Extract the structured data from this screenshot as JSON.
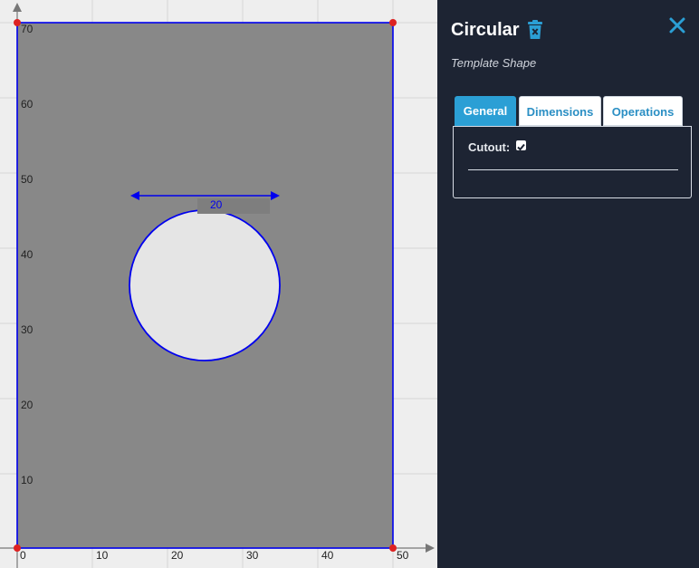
{
  "panel": {
    "title": "Circular",
    "subtitle": "Template Shape",
    "tabs": [
      {
        "label": "General",
        "active": true
      },
      {
        "label": "Dimensions",
        "active": false
      },
      {
        "label": "Operations",
        "active": false
      }
    ],
    "general": {
      "cutout_label": "Cutout:",
      "cutout_checked": true
    },
    "icons": {
      "delete": "trash-icon",
      "close": "close-icon"
    },
    "colors": {
      "background": "#1d2433",
      "accent": "#2b9fd5"
    }
  },
  "canvas": {
    "x_ticks": [
      "0",
      "10",
      "20",
      "30",
      "40",
      "50"
    ],
    "y_ticks": [
      "10",
      "20",
      "30",
      "40",
      "50",
      "60",
      "70"
    ],
    "dimension_label": "20",
    "colors": {
      "outline": "#0000ee",
      "fill": "#888888",
      "hole": "#e5e5e5",
      "vertex": "#dd2222"
    }
  }
}
